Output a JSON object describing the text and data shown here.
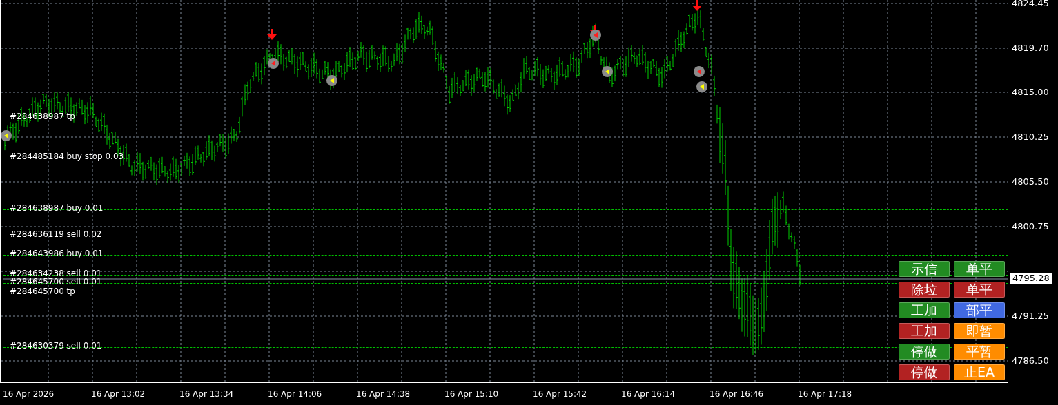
{
  "price_axis": {
    "labels": [
      "4824.45",
      "4819.70",
      "4815.00",
      "4810.25",
      "4805.50",
      "4800.75",
      "4791.25",
      "4786.50"
    ],
    "current_price": "4795.28"
  },
  "time_axis": {
    "labels": [
      "16 Apr 2026",
      "16 Apr 13:02",
      "16 Apr 13:34",
      "16 Apr 14:06",
      "16 Apr 14:38",
      "16 Apr 15:10",
      "16 Apr 15:42",
      "16 Apr 16:14",
      "16 Apr 16:46",
      "16 Apr 17:18"
    ]
  },
  "order_lines": [
    {
      "label": "#284638987 tp",
      "color": "#ff0000"
    },
    {
      "label": "#284485184 buy stop 0.03",
      "color": "#00c000"
    },
    {
      "label": "#284638987 buy 0.01",
      "color": "#00c000"
    },
    {
      "label": "#284636119 sell 0.02",
      "color": "#00c000"
    },
    {
      "label": "#284643986 buy 0.01",
      "color": "#00c000"
    },
    {
      "label": "#284634238 sell 0.01",
      "color": "#00c000"
    },
    {
      "label": "#284645700 sell 0.01",
      "color": "#00c000"
    },
    {
      "label": "#284645700 tp",
      "color": "#ff0000"
    },
    {
      "label": "#284630379 sell 0.01",
      "color": "#00c000"
    }
  ],
  "buttons": [
    {
      "label": "示信",
      "color": "#228b22"
    },
    {
      "label": "单平",
      "color": "#228b22"
    },
    {
      "label": "除垃",
      "color": "#b22222"
    },
    {
      "label": "单平",
      "color": "#b22222"
    },
    {
      "label": "工加",
      "color": "#228b22"
    },
    {
      "label": "部平",
      "color": "#4169e1"
    },
    {
      "label": "工加",
      "color": "#b22222"
    },
    {
      "label": "即暂",
      "color": "#ff8c00"
    },
    {
      "label": "停做",
      "color": "#228b22"
    },
    {
      "label": "平暂",
      "color": "#ff8c00"
    },
    {
      "label": "停做",
      "color": "#b22222"
    },
    {
      "label": "止EA",
      "color": "#ff8c00"
    }
  ]
}
